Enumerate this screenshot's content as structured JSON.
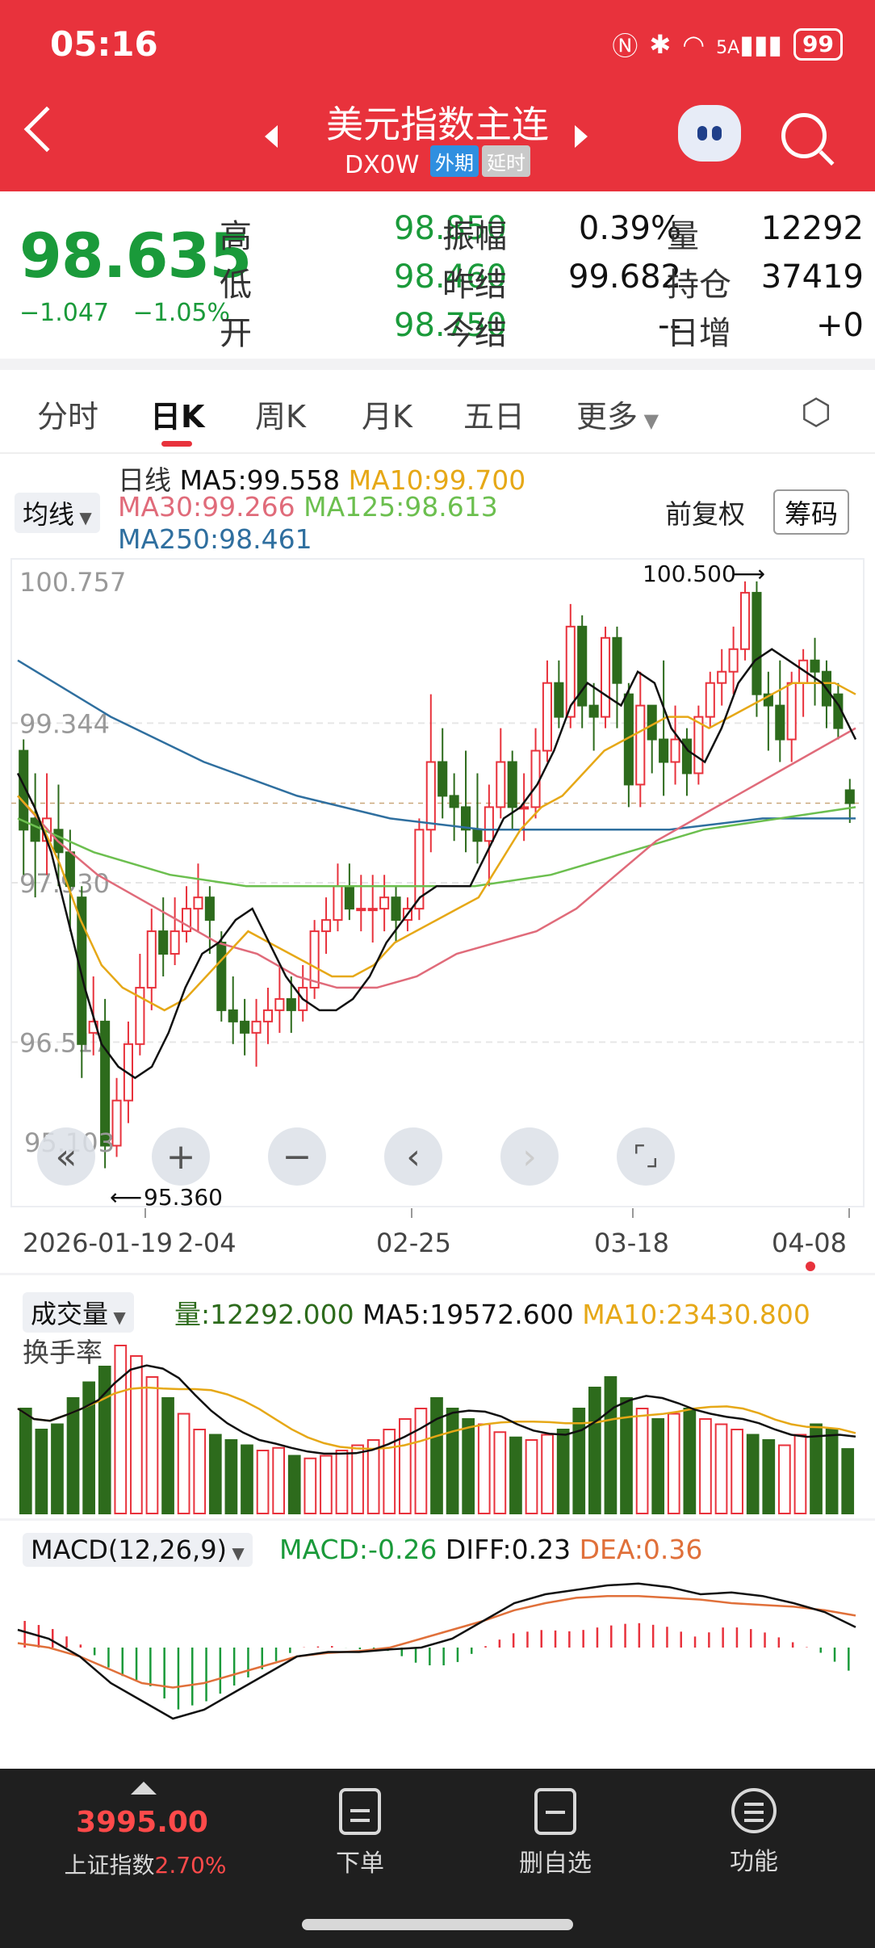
{
  "status": {
    "time": "05:16",
    "battery": "99",
    "signal_label": "5A"
  },
  "header": {
    "title": "美元指数主连",
    "code": "DX0W",
    "tag_foreign": "外期",
    "tag_delay": "延时"
  },
  "quote": {
    "price": "98.635",
    "change": "−1.047",
    "change_pct": "−1.05%",
    "rows": [
      [
        {
          "label": "高",
          "value": "98.850"
        },
        {
          "label": "振幅",
          "value": "0.39%"
        },
        {
          "label": "量",
          "value": "12292"
        }
      ],
      [
        {
          "label": "低",
          "value": "98.460"
        },
        {
          "label": "昨结",
          "value": "99.682"
        },
        {
          "label": "持仓",
          "value": "37419"
        }
      ],
      [
        {
          "label": "开",
          "value": "98.750"
        },
        {
          "label": "今结",
          "value": "--"
        },
        {
          "label": "日增",
          "value": "+0"
        }
      ]
    ]
  },
  "tabs": [
    "分时",
    "日K",
    "周K",
    "月K",
    "五日",
    "更多"
  ],
  "kline_legend": {
    "selector": "均线",
    "series_label": "日线",
    "ma5": "MA5:99.558",
    "ma10": "MA10:99.700",
    "ma30": "MA30:99.266",
    "ma125": "MA125:98.613",
    "ma250": "MA250:98.461",
    "adjust": "前复权",
    "chips": "筹码"
  },
  "price_axis": [
    "100.757",
    "99.344",
    "97.930",
    "96.517",
    "95.103"
  ],
  "annotations": {
    "high": "100.500",
    "low": "95.360"
  },
  "date_axis": [
    "2026-01-19",
    "2-04",
    "02-25",
    "03-18",
    "04-08"
  ],
  "volume_legend": {
    "selector": "成交量",
    "vol": "量:12292.000",
    "ma5": "MA5:19572.600",
    "ma10": "MA10:23430.800",
    "turnover": "换手率"
  },
  "macd_legend": {
    "selector": "MACD(12,26,9)",
    "macd": "MACD:-0.26",
    "diff": "DIFF:0.23",
    "dea": "DEA:0.36"
  },
  "bottom_nav": {
    "index_value": "3995.00",
    "index_name": "上证指数",
    "index_pct": "2.70%",
    "order": "下单",
    "remove_watch": "删自选",
    "functions": "功能"
  },
  "colors": {
    "up": "#e8323c",
    "down": "#2d6b1c",
    "ma5": "#111111",
    "ma10": "#e6a817",
    "ma30": "#e06b7a",
    "ma125": "#6cbf4f",
    "ma250": "#2f6f9f"
  },
  "chart_data": {
    "type": "candlestick",
    "x_range": [
      "2026-01-19",
      "2026-04-08"
    ],
    "ylim": [
      95.103,
      100.757
    ],
    "y_ticks": [
      100.757,
      99.344,
      97.93,
      96.517,
      95.103
    ],
    "candles": [
      [
        99.1,
        98.4,
        99.2,
        98.0
      ],
      [
        98.5,
        98.3,
        98.9,
        97.8
      ],
      [
        98.3,
        98.5,
        98.9,
        98.0
      ],
      [
        98.4,
        98.2,
        98.8,
        97.9
      ],
      [
        98.2,
        97.9,
        98.4,
        97.5
      ],
      [
        97.8,
        96.5,
        97.9,
        96.2
      ],
      [
        96.6,
        96.7,
        97.1,
        96.4
      ],
      [
        96.7,
        95.6,
        96.9,
        95.4
      ],
      [
        95.6,
        96.0,
        96.2,
        95.5
      ],
      [
        96.0,
        96.5,
        96.7,
        95.8
      ],
      [
        96.5,
        97.0,
        97.3,
        96.4
      ],
      [
        97.0,
        97.5,
        97.7,
        96.8
      ],
      [
        97.5,
        97.3,
        97.8,
        97.1
      ],
      [
        97.3,
        97.5,
        97.8,
        97.2
      ],
      [
        97.5,
        97.7,
        97.9,
        97.4
      ],
      [
        97.7,
        97.8,
        98.1,
        97.5
      ],
      [
        97.8,
        97.6,
        97.9,
        97.3
      ],
      [
        97.4,
        96.8,
        97.5,
        96.7
      ],
      [
        96.8,
        96.7,
        97.1,
        96.5
      ],
      [
        96.7,
        96.6,
        96.9,
        96.4
      ],
      [
        96.6,
        96.7,
        96.9,
        96.3
      ],
      [
        96.7,
        96.8,
        97.0,
        96.5
      ],
      [
        96.8,
        96.9,
        97.2,
        96.6
      ],
      [
        96.9,
        96.8,
        97.1,
        96.6
      ],
      [
        96.8,
        97.0,
        97.2,
        96.7
      ],
      [
        97.0,
        97.5,
        97.6,
        96.9
      ],
      [
        97.5,
        97.6,
        97.8,
        97.3
      ],
      [
        97.6,
        97.9,
        98.1,
        97.5
      ],
      [
        97.9,
        97.7,
        98.1,
        97.6
      ],
      [
        97.7,
        97.7,
        98.0,
        97.5
      ],
      [
        97.7,
        97.7,
        98.0,
        97.4
      ],
      [
        97.7,
        97.8,
        98.0,
        97.5
      ],
      [
        97.8,
        97.6,
        97.9,
        97.4
      ],
      [
        97.6,
        97.7,
        97.8,
        97.5
      ],
      [
        97.7,
        98.4,
        98.5,
        97.6
      ],
      [
        98.4,
        99.0,
        99.6,
        98.2
      ],
      [
        99.0,
        98.7,
        99.3,
        98.5
      ],
      [
        98.7,
        98.6,
        98.9,
        98.3
      ],
      [
        98.6,
        98.4,
        99.1,
        98.2
      ],
      [
        98.4,
        98.3,
        98.9,
        98.1
      ],
      [
        98.3,
        98.6,
        98.8,
        97.9
      ],
      [
        98.6,
        99.0,
        99.3,
        98.5
      ],
      [
        99.0,
        98.6,
        99.1,
        98.4
      ],
      [
        98.6,
        98.6,
        98.9,
        98.3
      ],
      [
        98.6,
        99.1,
        99.3,
        98.5
      ],
      [
        99.1,
        99.7,
        99.9,
        99.0
      ],
      [
        99.7,
        99.4,
        99.9,
        99.3
      ],
      [
        99.4,
        100.2,
        100.4,
        99.3
      ],
      [
        100.2,
        99.5,
        100.3,
        99.3
      ],
      [
        99.5,
        99.4,
        99.7,
        99.1
      ],
      [
        99.4,
        100.1,
        100.2,
        99.3
      ],
      [
        100.1,
        99.7,
        100.2,
        99.3
      ],
      [
        99.6,
        98.8,
        99.7,
        98.6
      ],
      [
        98.8,
        99.5,
        99.8,
        98.6
      ],
      [
        99.5,
        99.2,
        99.5,
        98.9
      ],
      [
        99.2,
        99.0,
        99.9,
        98.7
      ],
      [
        99.0,
        99.2,
        99.5,
        98.8
      ],
      [
        99.2,
        98.9,
        99.3,
        98.7
      ],
      [
        98.9,
        99.4,
        99.5,
        98.8
      ],
      [
        99.4,
        99.7,
        99.8,
        99.3
      ],
      [
        99.7,
        99.8,
        100.0,
        99.5
      ],
      [
        99.8,
        100.0,
        100.2,
        99.6
      ],
      [
        100.0,
        100.5,
        100.6,
        99.9
      ],
      [
        100.5,
        99.6,
        100.6,
        99.4
      ],
      [
        99.6,
        99.5,
        99.8,
        99.1
      ],
      [
        99.5,
        99.2,
        99.9,
        99.0
      ],
      [
        99.2,
        99.7,
        99.8,
        99.0
      ],
      [
        99.7,
        99.9,
        100.0,
        99.4
      ],
      [
        99.9,
        99.8,
        100.1,
        99.5
      ],
      [
        99.8,
        99.5,
        99.9,
        99.3
      ],
      [
        99.6,
        99.3,
        99.7,
        99.2
      ],
      [
        98.75,
        98.635,
        98.85,
        98.46
      ]
    ],
    "ma5": [
      98.9,
      98.6,
      98.2,
      97.6,
      97.0,
      96.5,
      96.3,
      96.2,
      96.3,
      96.6,
      97.0,
      97.3,
      97.4,
      97.6,
      97.7,
      97.4,
      97.1,
      96.9,
      96.8,
      96.8,
      96.9,
      97.1,
      97.4,
      97.6,
      97.8,
      97.9,
      97.9,
      97.9,
      98.2,
      98.5,
      98.6,
      98.8,
      99.1,
      99.5,
      99.7,
      99.6,
      99.5,
      99.8,
      99.7,
      99.3,
      99.1,
      99.0,
      99.3,
      99.7,
      99.9,
      100.0,
      99.9,
      99.8,
      99.7,
      99.5,
      99.2
    ],
    "ma10": [
      98.7,
      98.5,
      98.1,
      97.6,
      97.2,
      97.0,
      96.9,
      96.8,
      96.9,
      97.1,
      97.3,
      97.5,
      97.4,
      97.3,
      97.2,
      97.1,
      97.1,
      97.2,
      97.4,
      97.5,
      97.6,
      97.7,
      97.8,
      98.1,
      98.4,
      98.6,
      98.7,
      98.9,
      99.1,
      99.2,
      99.3,
      99.4,
      99.4,
      99.3,
      99.4,
      99.5,
      99.6,
      99.7,
      99.7,
      99.7,
      99.6
    ],
    "ma30": [
      98.7,
      98.3,
      98.0,
      97.8,
      97.6,
      97.4,
      97.3,
      97.1,
      97.0,
      97.0,
      97.1,
      97.3,
      97.4,
      97.5,
      97.7,
      98.0,
      98.3,
      98.5,
      98.7,
      98.9,
      99.1,
      99.3
    ],
    "ma125": [
      98.5,
      98.2,
      98.0,
      97.9,
      97.9,
      97.9,
      97.9,
      98.0,
      98.2,
      98.4,
      98.5,
      98.6
    ],
    "ma250": [
      99.9,
      99.4,
      99.0,
      98.7,
      98.5,
      98.4,
      98.4,
      98.4,
      98.5,
      98.5
    ],
    "volume": [
      20000,
      16000,
      17000,
      22000,
      25000,
      28000,
      32000,
      30000,
      26000,
      22000,
      19000,
      16000,
      15000,
      14000,
      13000,
      12000,
      12500,
      11000,
      10500,
      11000,
      12000,
      13000,
      14000,
      16000,
      18000,
      20000,
      22000,
      20000,
      18000,
      17000,
      15500,
      14500,
      14000,
      15000,
      16000,
      20000,
      24000,
      26000,
      22000,
      20000,
      18000,
      19000,
      20000,
      18000,
      17000,
      16000,
      15000,
      14000,
      13000,
      15000,
      17000,
      16000,
      12292
    ],
    "macd_dif": [
      0.2,
      0.1,
      -0.1,
      -0.4,
      -0.6,
      -0.8,
      -0.7,
      -0.5,
      -0.3,
      -0.1,
      -0.05,
      -0.05,
      -0.02,
      0.0,
      0.1,
      0.3,
      0.5,
      0.6,
      0.65,
      0.7,
      0.72,
      0.68,
      0.6,
      0.62,
      0.58,
      0.5,
      0.4,
      0.23
    ],
    "macd_dea": [
      0.05,
      0.0,
      -0.1,
      -0.25,
      -0.4,
      -0.45,
      -0.4,
      -0.3,
      -0.2,
      -0.1,
      -0.06,
      -0.04,
      0.0,
      0.1,
      0.2,
      0.3,
      0.42,
      0.5,
      0.56,
      0.58,
      0.58,
      0.56,
      0.54,
      0.5,
      0.48,
      0.46,
      0.42,
      0.36
    ]
  }
}
